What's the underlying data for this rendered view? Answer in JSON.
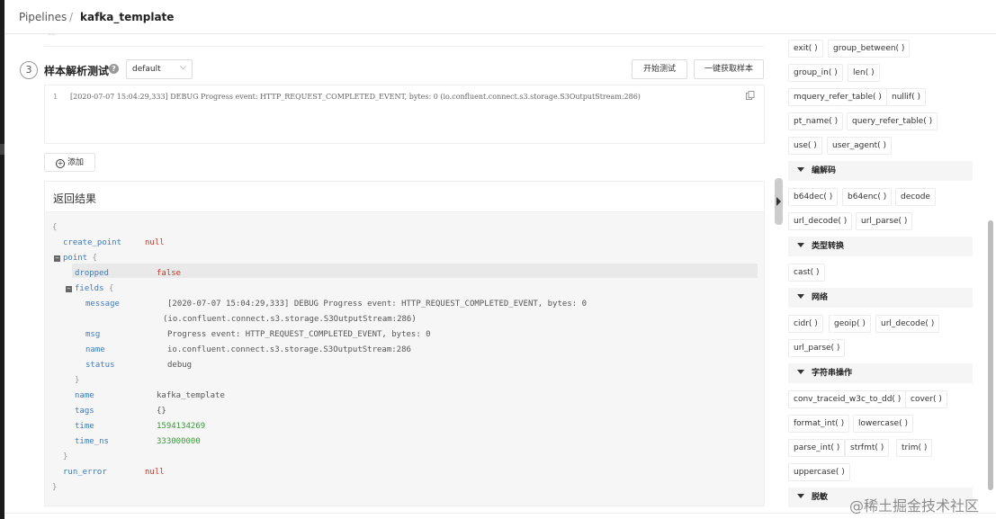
{
  "breadcrumb": {
    "root": "Pipelines",
    "sep": "/",
    "current": "kafka_template"
  },
  "step": {
    "number": "3",
    "title": "样本解析测试",
    "select_value": "default",
    "btn_test": "开始测试",
    "btn_fetch": "一键获取样本",
    "prev_block_glyph": "\"\""
  },
  "sample": {
    "line_no": "1",
    "text": "[2020-07-07 15:04:29,333] DEBUG Progress event: HTTP_REQUEST_COMPLETED_EVENT, bytes: 0 (io.confluent.connect.s3.storage.S3OutputStream:286)"
  },
  "add_button": {
    "label": "添加"
  },
  "result": {
    "title": "返回结果",
    "lines": {
      "open": "{",
      "create_point_key": "create_point",
      "create_point_val": "null",
      "point_key": "point",
      "point_open": "{",
      "dropped_key": "dropped",
      "dropped_val": "false",
      "fields_key": "fields",
      "fields_open": "{",
      "message_key": "message",
      "message_val_1": "[2020-07-07 15:04:29,333] DEBUG Progress event: HTTP_REQUEST_COMPLETED_EVENT, bytes: 0",
      "message_val_2": "(io.confluent.connect.s3.storage.S3OutputStream:286)",
      "msg_key": "msg",
      "msg_val": "Progress event: HTTP_REQUEST_COMPLETED_EVENT, bytes: 0",
      "name1_key": "name",
      "name1_val": "io.confluent.connect.s3.storage.S3OutputStream:286",
      "status_key": "status",
      "status_val": "debug",
      "fields_close": "}",
      "name2_key": "name",
      "name2_val": "kafka_template",
      "tags_key": "tags",
      "tags_val": "{}",
      "time_key": "time",
      "time_val": "1594134269",
      "time_ns_key": "time_ns",
      "time_ns_val": "333000000",
      "point_close": "}",
      "run_error_key": "run_error",
      "run_error_val": "null",
      "close": "}"
    }
  },
  "sidebar": {
    "fn_group_top": [
      "exit( )",
      "group_between( )",
      "group_in( )",
      "len( )",
      "mquery_refer_table( )",
      "nullif( )",
      "pt_name( )",
      "query_refer_table( )",
      "use( )",
      "user_agent( )"
    ],
    "categories": {
      "codec": {
        "label": "编解码",
        "items": [
          "b64dec( )",
          "b64enc( )",
          "decode",
          "url_decode( )",
          "url_parse( )"
        ]
      },
      "type_conv": {
        "label": "类型转换",
        "items": [
          "cast( )"
        ]
      },
      "network": {
        "label": "网络",
        "items": [
          "cidr( )",
          "geoip( )",
          "url_decode( )",
          "url_parse( )"
        ]
      },
      "string_ops": {
        "label": "字符串操作",
        "items": [
          "conv_traceid_w3c_to_dd( )",
          "cover( )",
          "format_int( )",
          "lowercase( )",
          "parse_int( )",
          "strfmt( )",
          "trim( )",
          "uppercase( )"
        ]
      },
      "desensitize": {
        "label": "脱敏"
      }
    }
  },
  "watermark": "@稀土掘金技术社区"
}
